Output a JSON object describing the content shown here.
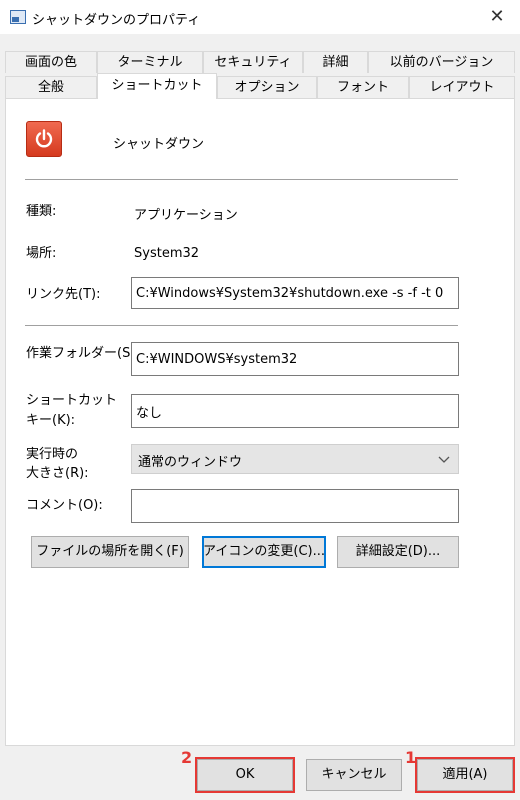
{
  "window": {
    "title": "シャットダウンのプロパティ",
    "close_glyph": "✕"
  },
  "tabs_row1": [
    {
      "label": "画面の色"
    },
    {
      "label": "ターミナル"
    },
    {
      "label": "セキュリティ"
    },
    {
      "label": "詳細"
    },
    {
      "label": "以前のバージョン"
    }
  ],
  "tabs_row2": [
    {
      "label": "全般"
    },
    {
      "label": "ショートカット",
      "active": true
    },
    {
      "label": "オプション"
    },
    {
      "label": "フォント"
    },
    {
      "label": "レイアウト"
    }
  ],
  "shortcut": {
    "name": "シャットダウン",
    "icon": "power-icon"
  },
  "fields": {
    "type_label": "種類:",
    "type_value": "アプリケーション",
    "location_label": "場所:",
    "location_value": "System32",
    "target_label": "リンク先(T):",
    "target_value": "C:¥Windows¥System32¥shutdown.exe -s -f -t 0",
    "start_in_label": "作業フォルダー(S):",
    "start_in_value": "C:¥WINDOWS¥system32",
    "shortcut_key_label_1": "ショートカット",
    "shortcut_key_label_2": "キー(K):",
    "shortcut_key_value": "なし",
    "run_label_1": "実行時の",
    "run_label_2": "大きさ(R):",
    "run_value": "通常のウィンドウ",
    "comment_label": "コメント(O):",
    "comment_value": ""
  },
  "buttons": {
    "open_location": "ファイルの場所を開く(F)",
    "change_icon": "アイコンの変更(C)...",
    "advanced": "詳細設定(D)...",
    "ok": "OK",
    "cancel": "キャンセル",
    "apply": "適用(A)"
  },
  "annotations": {
    "step1": "1",
    "step2": "2",
    "color": "#e53935"
  },
  "colors": {
    "accent": "#0078d7",
    "power_icon": "#e0452a"
  }
}
